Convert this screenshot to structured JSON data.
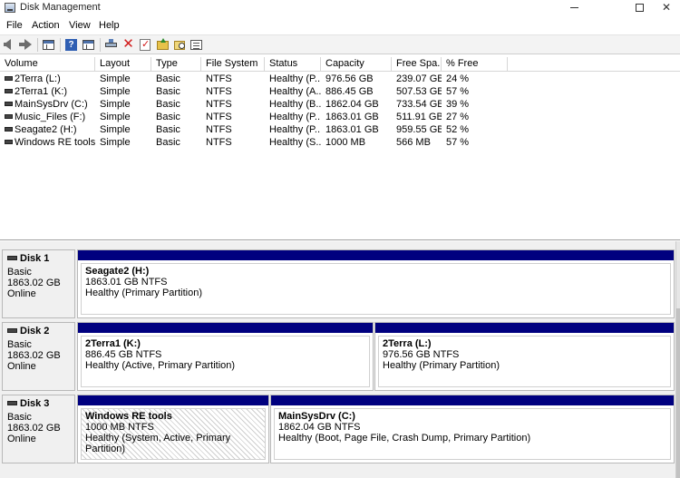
{
  "window": {
    "title": "Disk Management"
  },
  "menu": [
    "File",
    "Action",
    "View",
    "Help"
  ],
  "toolbar": {
    "icons": [
      "back-arrow-icon",
      "forward-arrow-icon",
      "show-hide-console-tree-icon",
      "help-icon",
      "properties-panel-icon",
      "connect-disk-icon",
      "delete-icon",
      "check-icon",
      "up-folder-icon",
      "search-folder-icon",
      "properties-icon"
    ]
  },
  "columns": [
    "Volume",
    "Layout",
    "Type",
    "File System",
    "Status",
    "Capacity",
    "Free Spa...",
    "% Free"
  ],
  "volumes": [
    {
      "volume": "2Terra (L:)",
      "layout": "Simple",
      "type": "Basic",
      "fs": "NTFS",
      "status": "Healthy (P...",
      "capacity": "976.56 GB",
      "free": "239.07 GB",
      "pct": "24 %"
    },
    {
      "volume": "2Terra1 (K:)",
      "layout": "Simple",
      "type": "Basic",
      "fs": "NTFS",
      "status": "Healthy (A...",
      "capacity": "886.45 GB",
      "free": "507.53 GB",
      "pct": "57 %"
    },
    {
      "volume": "MainSysDrv (C:)",
      "layout": "Simple",
      "type": "Basic",
      "fs": "NTFS",
      "status": "Healthy (B...",
      "capacity": "1862.04 GB",
      "free": "733.54 GB",
      "pct": "39 %"
    },
    {
      "volume": "Music_Files (F:)",
      "layout": "Simple",
      "type": "Basic",
      "fs": "NTFS",
      "status": "Healthy (P...",
      "capacity": "1863.01 GB",
      "free": "511.91 GB",
      "pct": "27 %"
    },
    {
      "volume": "Seagate2 (H:)",
      "layout": "Simple",
      "type": "Basic",
      "fs": "NTFS",
      "status": "Healthy (P...",
      "capacity": "1863.01 GB",
      "free": "959.55 GB",
      "pct": "52 %"
    },
    {
      "volume": "Windows RE tools",
      "layout": "Simple",
      "type": "Basic",
      "fs": "NTFS",
      "status": "Healthy (S...",
      "capacity": "1000 MB",
      "free": "566 MB",
      "pct": "57 %"
    }
  ],
  "disks": [
    {
      "name": "Disk 1",
      "type": "Basic",
      "size": "1863.02 GB",
      "state": "Online",
      "partitions": [
        {
          "title": "Seagate2  (H:)",
          "size": "1863.01 GB NTFS",
          "status": "Healthy (Primary Partition)"
        }
      ]
    },
    {
      "name": "Disk 2",
      "type": "Basic",
      "size": "1863.02 GB",
      "state": "Online",
      "partitions": [
        {
          "title": "2Terra1  (K:)",
          "size": "886.45 GB NTFS",
          "status": "Healthy (Active, Primary Partition)"
        },
        {
          "title": "2Terra  (L:)",
          "size": "976.56 GB NTFS",
          "status": "Healthy (Primary Partition)"
        }
      ]
    },
    {
      "name": "Disk 3",
      "type": "Basic",
      "size": "1863.02 GB",
      "state": "Online",
      "partitions": [
        {
          "title": "Windows RE tools",
          "size": "1000 MB NTFS",
          "status": "Healthy (System, Active, Primary Partition)"
        },
        {
          "title": "MainSysDrv  (C:)",
          "size": "1862.04 GB NTFS",
          "status": "Healthy (Boot, Page File, Crash Dump, Primary Partition)"
        }
      ]
    }
  ],
  "colors": {
    "partition_bar": "#00007f",
    "pane_background": "#f0f0f0"
  }
}
